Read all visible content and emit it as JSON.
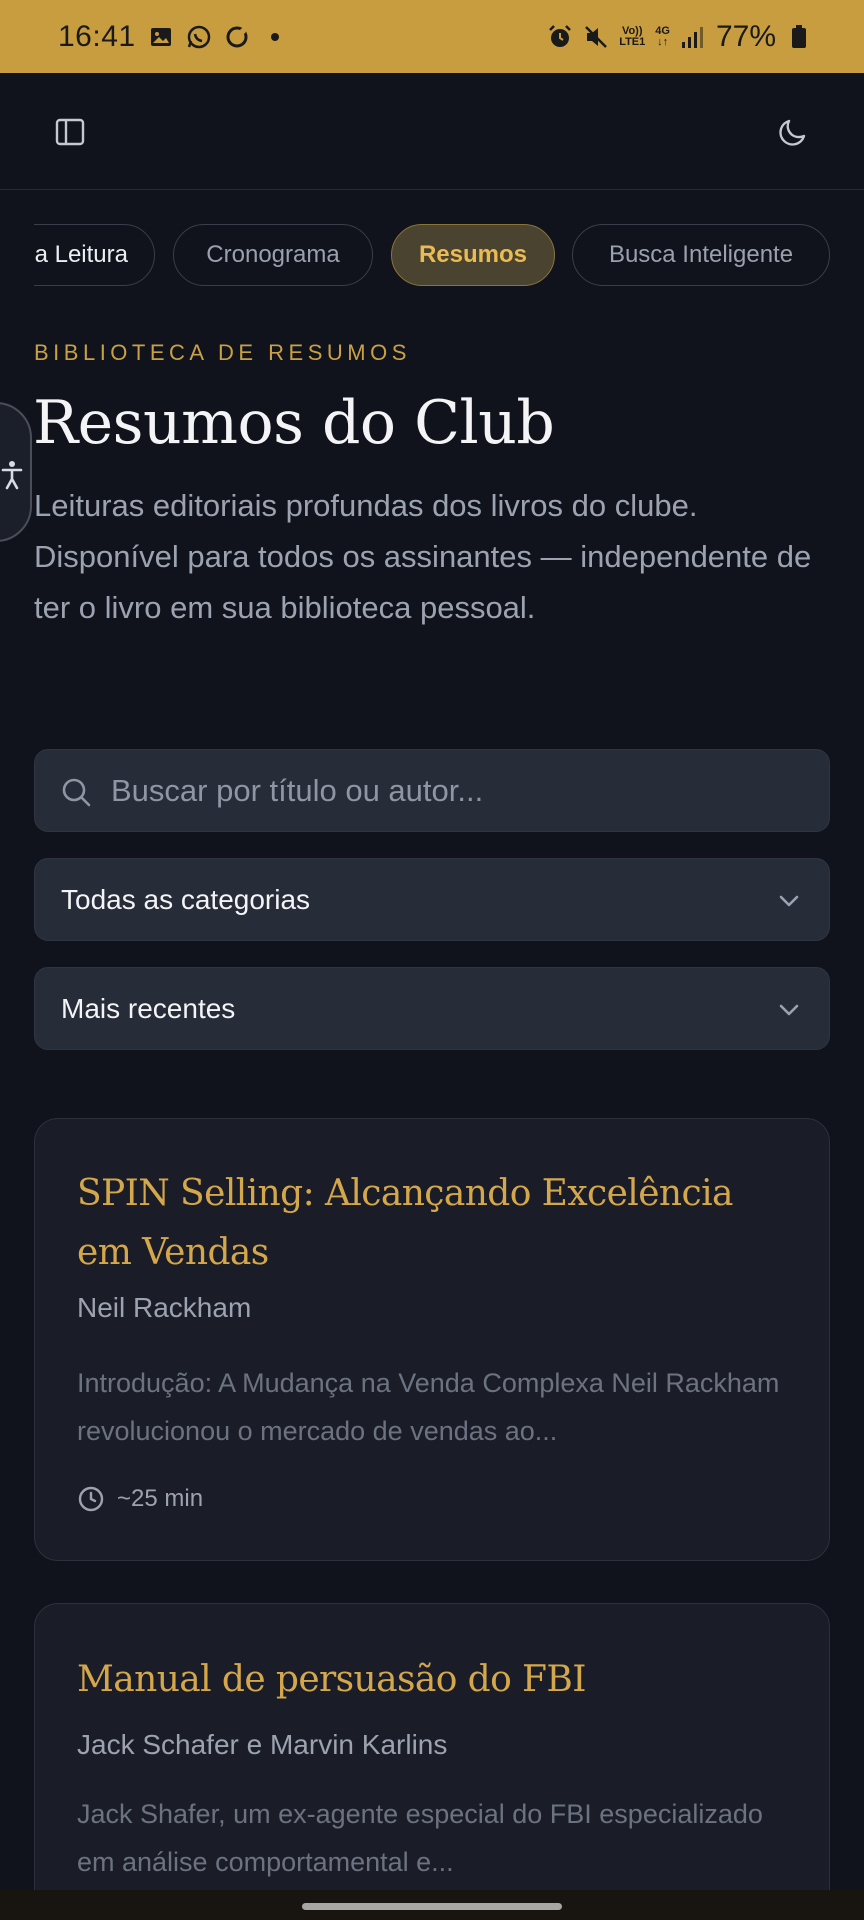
{
  "status_bar": {
    "time": "16:41",
    "left_icons": [
      "image-icon",
      "whatsapp-icon",
      "sync-icon",
      "dot-icon"
    ],
    "right_icons": [
      "alarm-icon",
      "mute-icon",
      "volte-icon",
      "4g-icon",
      "signal-icon",
      "battery-icon"
    ],
    "volte_top": "Vo))",
    "volte_bottom": "LTE1",
    "network": "4G",
    "battery": "77%"
  },
  "appbar": {
    "left_icon": "sidebar-toggle-icon",
    "right_icon": "moon-icon"
  },
  "tabs": [
    {
      "label": "a Leitura",
      "active": false
    },
    {
      "label": "Cronograma",
      "active": false
    },
    {
      "label": "Resumos",
      "active": true
    },
    {
      "label": "Busca Inteligente",
      "active": false
    }
  ],
  "header": {
    "eyebrow": "BIBLIOTECA DE RESUMOS",
    "title": "Resumos do Club",
    "subtitle": "Leituras editoriais profundas dos livros do clube. Disponível para todos os assinantes — independente de ter o livro em sua biblioteca pessoal."
  },
  "filters": {
    "search_placeholder": "Buscar por título ou autor...",
    "search_value": "",
    "category": "Todas as categorias",
    "sort": "Mais recentes"
  },
  "cards": [
    {
      "title": "SPIN Selling: Alcançando Excelência em Vendas",
      "author": "Neil Rackham",
      "excerpt": "Introdução: A Mudança na Venda Complexa Neil Rackham revolucionou o mercado de vendas ao...",
      "read_time": "~25 min"
    },
    {
      "title": "Manual de persuasão do FBI",
      "author": "Jack Schafer e Marvin Karlins",
      "excerpt": "Jack Shafer, um ex-agente especial do FBI especializado em análise comportamental e..."
    }
  ],
  "colors": {
    "status_bar": "#c89d3f",
    "background": "#10131c",
    "accent": "#d5a74b",
    "card": "#1a1d28",
    "control": "#262c38"
  }
}
